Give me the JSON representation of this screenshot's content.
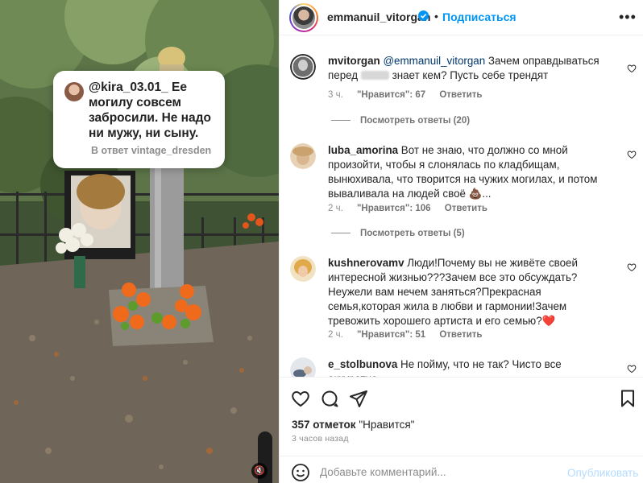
{
  "media": {
    "reply_card": {
      "handle": "@kira_03.01_",
      "text": "Ее могилу совсем забросили. Не надо ни мужу, ни сыну.",
      "reply_to": "В ответ vintage_dresden"
    },
    "mute_icon": "speaker-muted-icon"
  },
  "header": {
    "username": "emmanuil_vitorgan",
    "dot": "•",
    "follow_label": "Подписаться",
    "more_label": "•••"
  },
  "comments": [
    {
      "username": "mvitorgan",
      "mention": "@emmanuil_vitorgan",
      "text_before_blur": " Зачем оправдываться перед",
      "text_after_blur": " знает кем? Пусть себе трендят",
      "time": "3 ч.",
      "likes": "\"Нравится\": 67",
      "reply": "Ответить",
      "view_replies": "Посмотреть ответы (20)"
    },
    {
      "username": "luba_amorina",
      "text": " Вот не знаю, что должно со мной произойти, чтобы я слонялась по кладбищам, вынюхивала, что творится на чужих могилах, и потом вываливала на людей своё 💩...",
      "time": "2 ч.",
      "likes": "\"Нравится\": 106",
      "reply": "Ответить",
      "view_replies": "Посмотреть ответы (5)"
    },
    {
      "username": "kushnerovamv",
      "text": " Люди!Почему вы не живёте своей интересной жизнью???Зачем все это обсуждать?Неужели вам нечем заняться?Прекрасная семья,которая жила в любви и гармонии!Зачем тревожить хорошего артиста и его семью?❤️",
      "time": "2 ч.",
      "likes": "\"Нравится\": 51",
      "reply": "Ответить"
    },
    {
      "username": "e_stolbunova",
      "text": " Не пойму, что не так? Чисто все аккуратно."
    }
  ],
  "actions": {
    "like_icon": "heart-icon",
    "comment_icon": "comment-bubble-icon",
    "share_icon": "send-icon",
    "save_icon": "bookmark-icon"
  },
  "likes": {
    "count": "357 отметок",
    "suffix": " \"Нравится\""
  },
  "time_ago": "3 часов назад",
  "add_comment": {
    "placeholder": "Добавьте комментарий...",
    "post_label": "Опубликовать"
  },
  "colors": {
    "accent": "#0095f6",
    "verified": "#0095f6",
    "mention": "#00376b",
    "muted_text": "#8e8e8e"
  }
}
